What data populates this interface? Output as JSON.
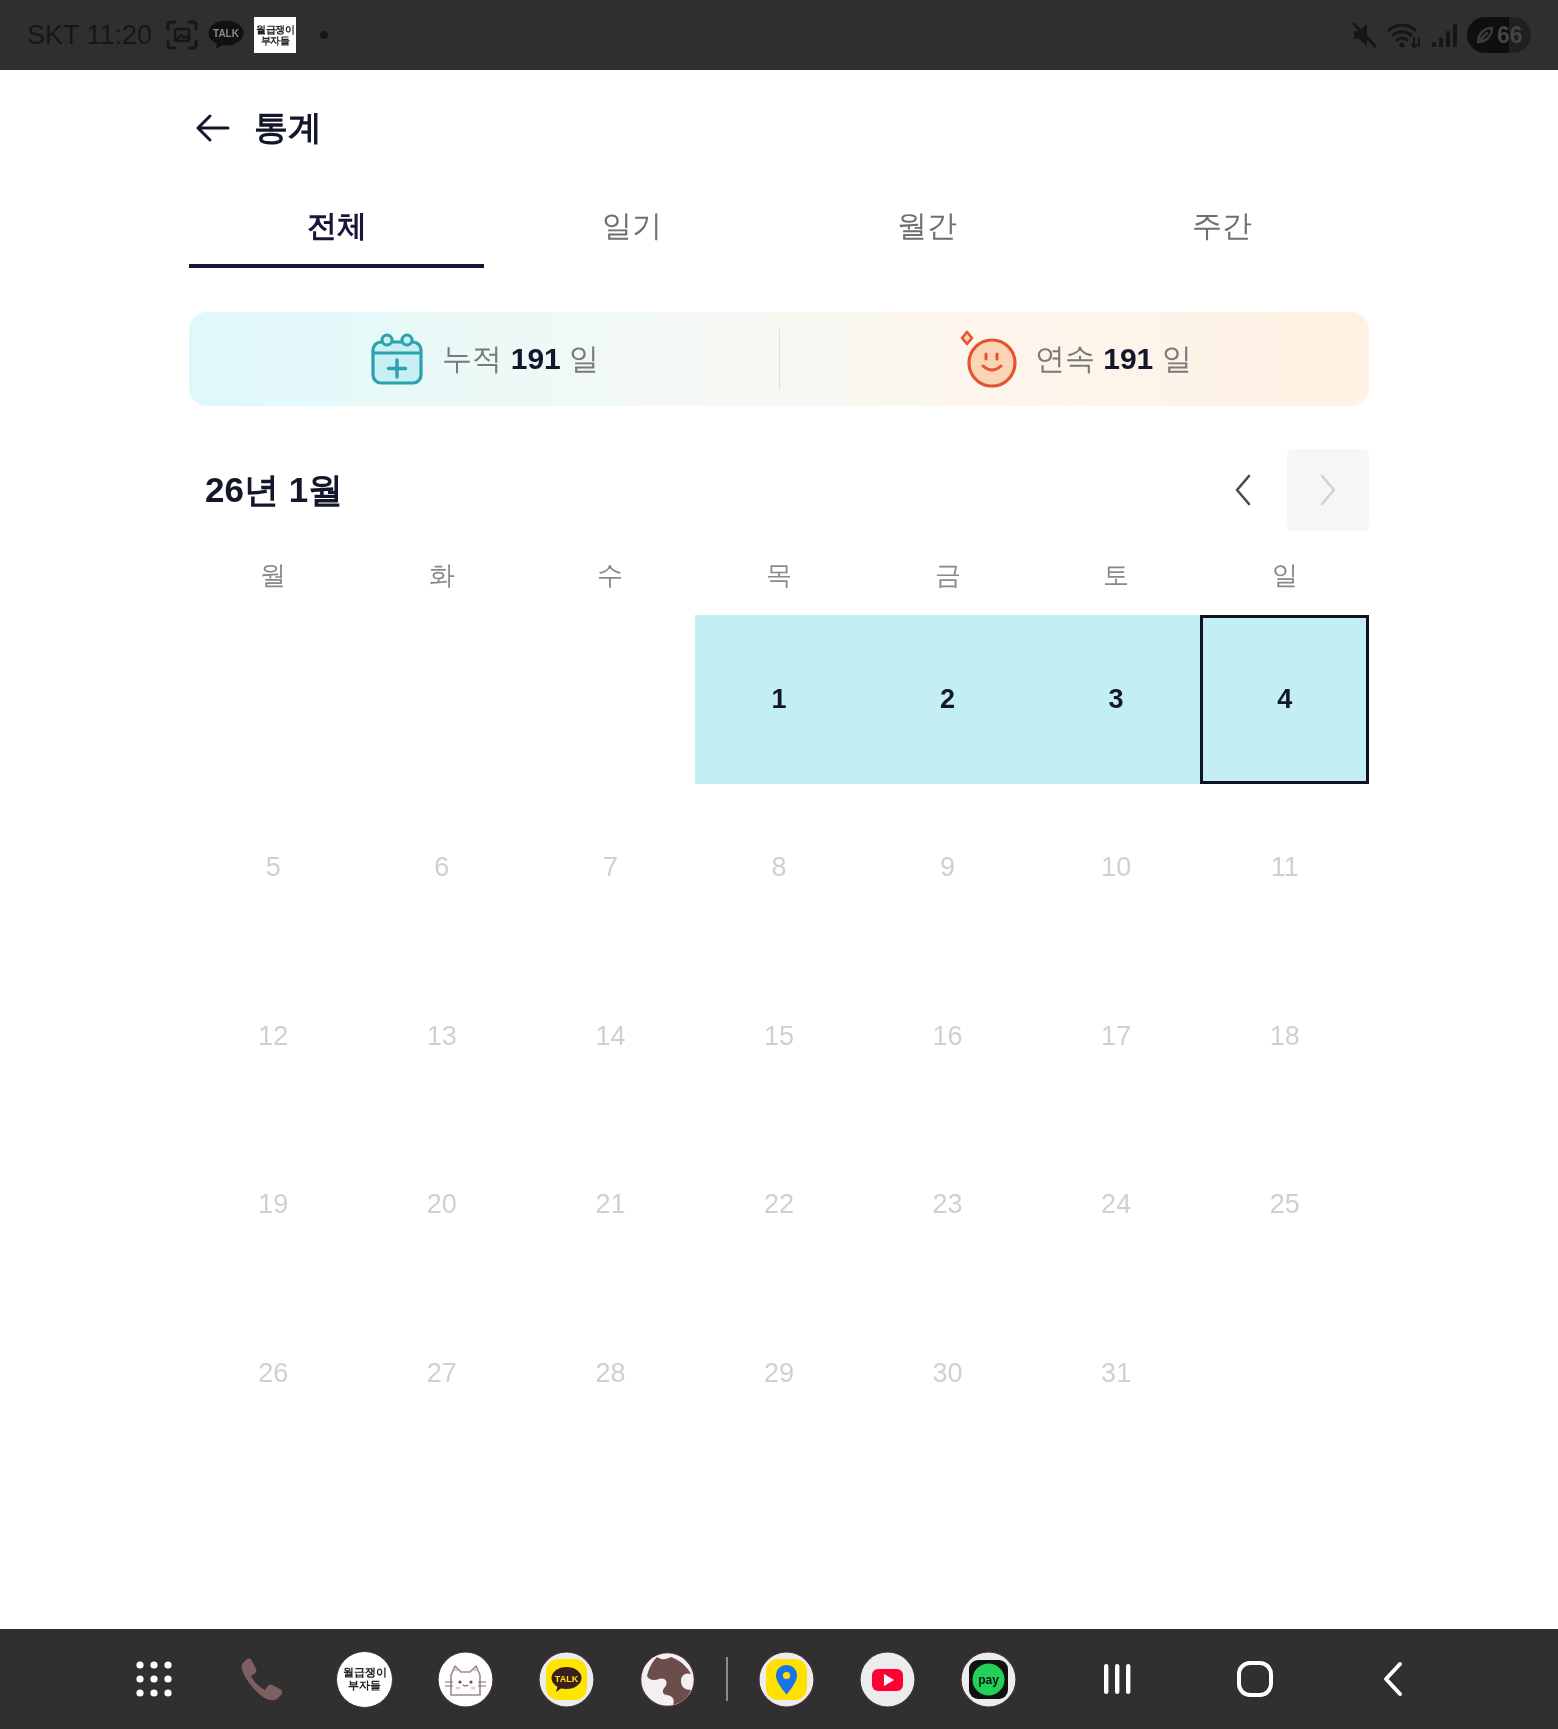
{
  "status_bar": {
    "clock": "SKT 11:20",
    "notifications": [
      {
        "kind": "screenshot"
      },
      {
        "kind": "talk",
        "label": "TALK"
      },
      {
        "kind": "app",
        "label": "월급쟁이 부자들"
      },
      {
        "kind": "dot"
      }
    ],
    "indicators": [
      {
        "kind": "mute"
      },
      {
        "kind": "wifi"
      },
      {
        "kind": "signal"
      },
      {
        "kind": "battery",
        "label": "66"
      }
    ]
  },
  "header": {
    "title": "통계"
  },
  "tabs": [
    {
      "label": "전체",
      "selected": true
    },
    {
      "label": "일기",
      "selected": false
    },
    {
      "label": "월간",
      "selected": false
    },
    {
      "label": "주간",
      "selected": false
    }
  ],
  "summary": [
    {
      "kind": "total",
      "text": "누적 **191** 일"
    },
    {
      "kind": "streak",
      "text": "연속 **191** 일"
    }
  ],
  "calendar": {
    "title": "26년 1월",
    "prev": {
      "disabled": false
    },
    "next": {
      "disabled": true
    },
    "weekdays": [
      "월",
      "화",
      "수",
      "목",
      "금",
      "토",
      "일"
    ],
    "weeks": [
      {
        "days": [
          {
            "kind": "blank"
          },
          {
            "kind": "blank"
          },
          {
            "kind": "blank"
          },
          {
            "kind": "day",
            "label": "1",
            "recorded": true,
            "selected": false,
            "disabled": false
          },
          {
            "kind": "day",
            "label": "2",
            "recorded": true,
            "selected": false,
            "disabled": false
          },
          {
            "kind": "day",
            "label": "3",
            "recorded": true,
            "selected": false,
            "disabled": false
          },
          {
            "kind": "day",
            "label": "4",
            "recorded": true,
            "selected": true,
            "disabled": false
          }
        ]
      },
      {
        "days": [
          {
            "kind": "day",
            "label": "5",
            "recorded": false,
            "selected": false,
            "disabled": true
          },
          {
            "kind": "day",
            "label": "6",
            "recorded": false,
            "selected": false,
            "disabled": true
          },
          {
            "kind": "day",
            "label": "7",
            "recorded": false,
            "selected": false,
            "disabled": true
          },
          {
            "kind": "day",
            "label": "8",
            "recorded": false,
            "selected": false,
            "disabled": true
          },
          {
            "kind": "day",
            "label": "9",
            "recorded": false,
            "selected": false,
            "disabled": true
          },
          {
            "kind": "day",
            "label": "10",
            "recorded": false,
            "selected": false,
            "disabled": true
          },
          {
            "kind": "day",
            "label": "11",
            "recorded": false,
            "selected": false,
            "disabled": true
          }
        ]
      },
      {
        "days": [
          {
            "kind": "day",
            "label": "12",
            "recorded": false,
            "selected": false,
            "disabled": true
          },
          {
            "kind": "day",
            "label": "13",
            "recorded": false,
            "selected": false,
            "disabled": true
          },
          {
            "kind": "day",
            "label": "14",
            "recorded": false,
            "selected": false,
            "disabled": true
          },
          {
            "kind": "day",
            "label": "15",
            "recorded": false,
            "selected": false,
            "disabled": true
          },
          {
            "kind": "day",
            "label": "16",
            "recorded": false,
            "selected": false,
            "disabled": true
          },
          {
            "kind": "day",
            "label": "17",
            "recorded": false,
            "selected": false,
            "disabled": true
          },
          {
            "kind": "day",
            "label": "18",
            "recorded": false,
            "selected": false,
            "disabled": true
          }
        ]
      },
      {
        "days": [
          {
            "kind": "day",
            "label": "19",
            "recorded": false,
            "selected": false,
            "disabled": true
          },
          {
            "kind": "day",
            "label": "20",
            "recorded": false,
            "selected": false,
            "disabled": true
          },
          {
            "kind": "day",
            "label": "21",
            "recorded": false,
            "selected": false,
            "disabled": true
          },
          {
            "kind": "day",
            "label": "22",
            "recorded": false,
            "selected": false,
            "disabled": true
          },
          {
            "kind": "day",
            "label": "23",
            "recorded": false,
            "selected": false,
            "disabled": true
          },
          {
            "kind": "day",
            "label": "24",
            "recorded": false,
            "selected": false,
            "disabled": true
          },
          {
            "kind": "day",
            "label": "25",
            "recorded": false,
            "selected": false,
            "disabled": true
          }
        ]
      },
      {
        "days": [
          {
            "kind": "day",
            "label": "26",
            "recorded": false,
            "selected": false,
            "disabled": true
          },
          {
            "kind": "day",
            "label": "27",
            "recorded": false,
            "selected": false,
            "disabled": true
          },
          {
            "kind": "day",
            "label": "28",
            "recorded": false,
            "selected": false,
            "disabled": true
          },
          {
            "kind": "day",
            "label": "29",
            "recorded": false,
            "selected": false,
            "disabled": true
          },
          {
            "kind": "day",
            "label": "30",
            "recorded": false,
            "selected": false,
            "disabled": true
          },
          {
            "kind": "day",
            "label": "31",
            "recorded": false,
            "selected": false,
            "disabled": true
          }
        ]
      }
    ]
  },
  "taskbar": {
    "pinned": [
      {
        "kind": "apps"
      },
      {
        "kind": "phone"
      },
      {
        "kind": "text",
        "label": "월급쟁이 부자들"
      },
      {
        "kind": "cat"
      },
      {
        "kind": "talk",
        "label": "TALK"
      },
      {
        "kind": "globe"
      }
    ],
    "recent": [
      {
        "kind": "map"
      },
      {
        "kind": "video"
      },
      {
        "kind": "pay",
        "label": "pay"
      }
    ],
    "nav_buttons": [
      {
        "kind": "recents"
      },
      {
        "kind": "home"
      },
      {
        "kind": "back"
      }
    ]
  }
}
